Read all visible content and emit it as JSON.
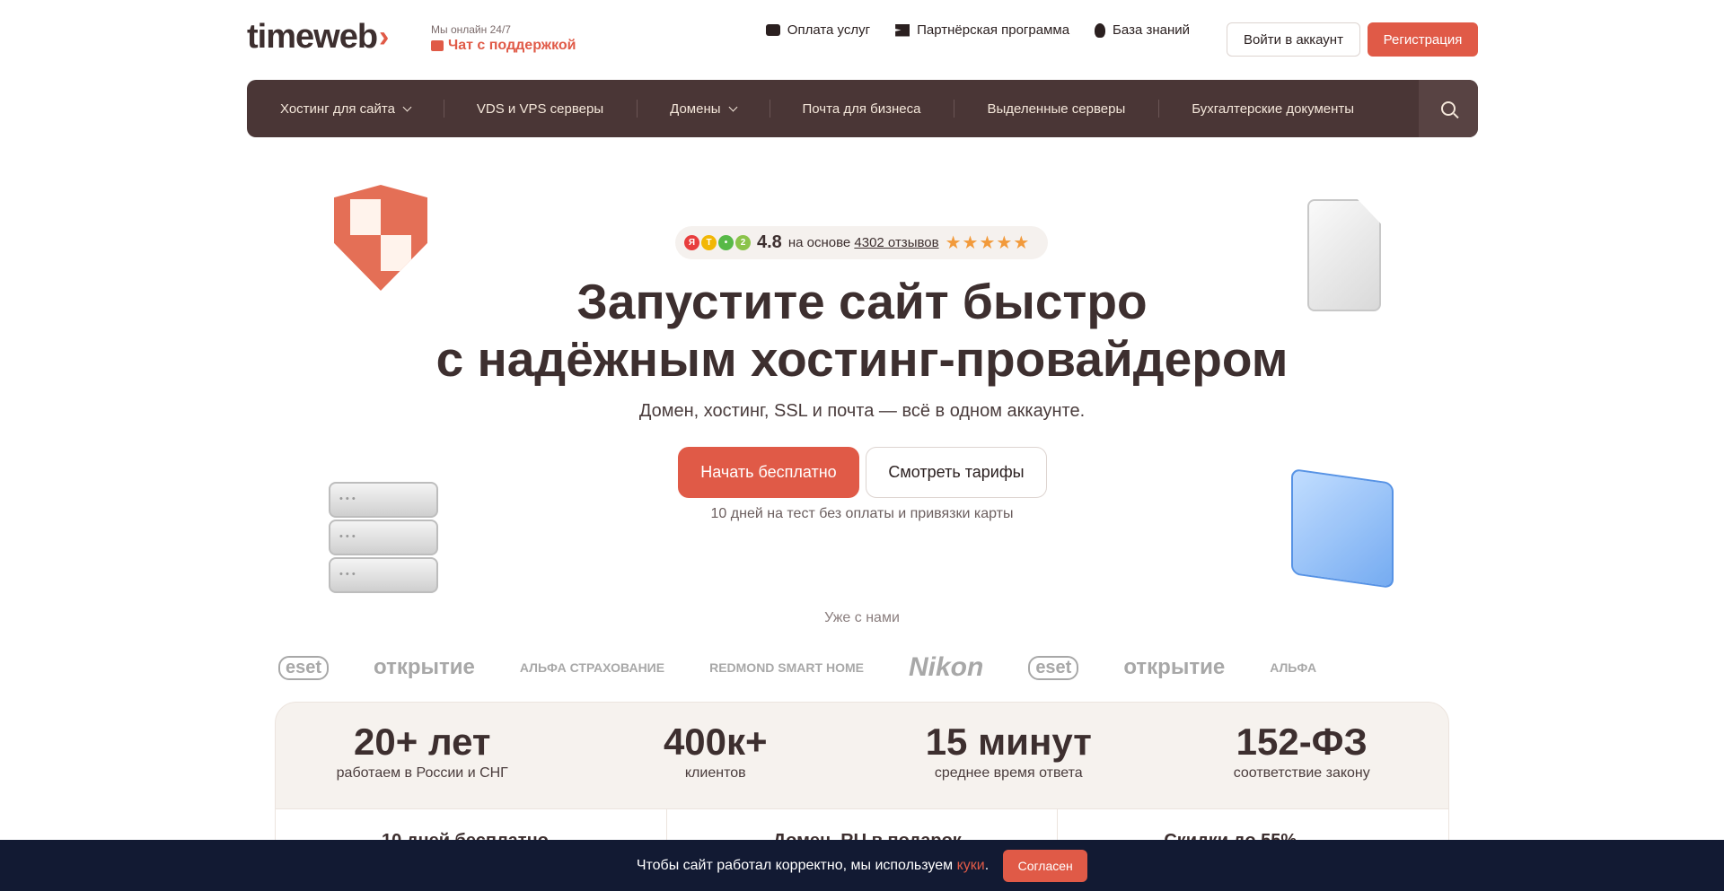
{
  "header": {
    "logo": "timeweb",
    "online_text": "Мы онлайн 24/7",
    "chat_link": "Чат с поддержкой",
    "links": [
      {
        "label": "Оплата услуг",
        "icon": "wallet-icon"
      },
      {
        "label": "Партнёрская программа",
        "icon": "partner-icon"
      },
      {
        "label": "База знаний",
        "icon": "bulb-icon"
      }
    ],
    "login_label": "Войти в аккаунт",
    "register_label": "Регистрация"
  },
  "nav": {
    "items": [
      {
        "label": "Хостинг для сайта",
        "has_dropdown": true
      },
      {
        "label": "VDS и VPS серверы",
        "has_dropdown": false
      },
      {
        "label": "Домены",
        "has_dropdown": true
      },
      {
        "label": "Почта для бизнеса",
        "has_dropdown": false
      },
      {
        "label": "Выделенные серверы",
        "has_dropdown": false
      },
      {
        "label": "Бухгалтерские документы",
        "has_dropdown": false
      }
    ]
  },
  "rating": {
    "score": "4.8",
    "prefix": "на основе",
    "count": "4302 отзывов",
    "stars": "★★★★★"
  },
  "hero": {
    "title_line1": "Запустите сайт быстро",
    "title_line2": "с надёжным хостинг-провайдером",
    "subtitle": "Домен, хостинг, SSL и почта — всё в одном аккаунте.",
    "start_label": "Начать бесплатно",
    "tariffs_label": "Смотреть тарифы",
    "note": "10 дней на тест без оплаты и привязки карты"
  },
  "partners": {
    "title": "Уже с нами",
    "logos": [
      "eset",
      "открытие",
      "АЛЬФА СТРАХОВАНИЕ",
      "REDMOND SMART HOME",
      "Nikon",
      "eset",
      "открытие",
      "АЛЬФА"
    ]
  },
  "stats": [
    {
      "value": "20+ лет",
      "label": "работаем в России и СНГ"
    },
    {
      "value": "400к+",
      "label": "клиентов"
    },
    {
      "value": "15 минут",
      "label": "среднее время ответа"
    },
    {
      "value": "152-ФЗ",
      "label": "соответствие закону"
    }
  ],
  "features": [
    "10 дней бесплатно",
    "Домен .RU в подарок",
    "Скидки до 55%"
  ],
  "cookie": {
    "text": "Чтобы сайт работал корректно, мы используем",
    "link": "куки",
    "dot": ".",
    "button": "Согласен"
  },
  "colors": {
    "accent": "#e05a47",
    "nav_bg": "#4a3636",
    "cookie_bg": "#121a33",
    "stats_bg": "#f6f2ee"
  }
}
